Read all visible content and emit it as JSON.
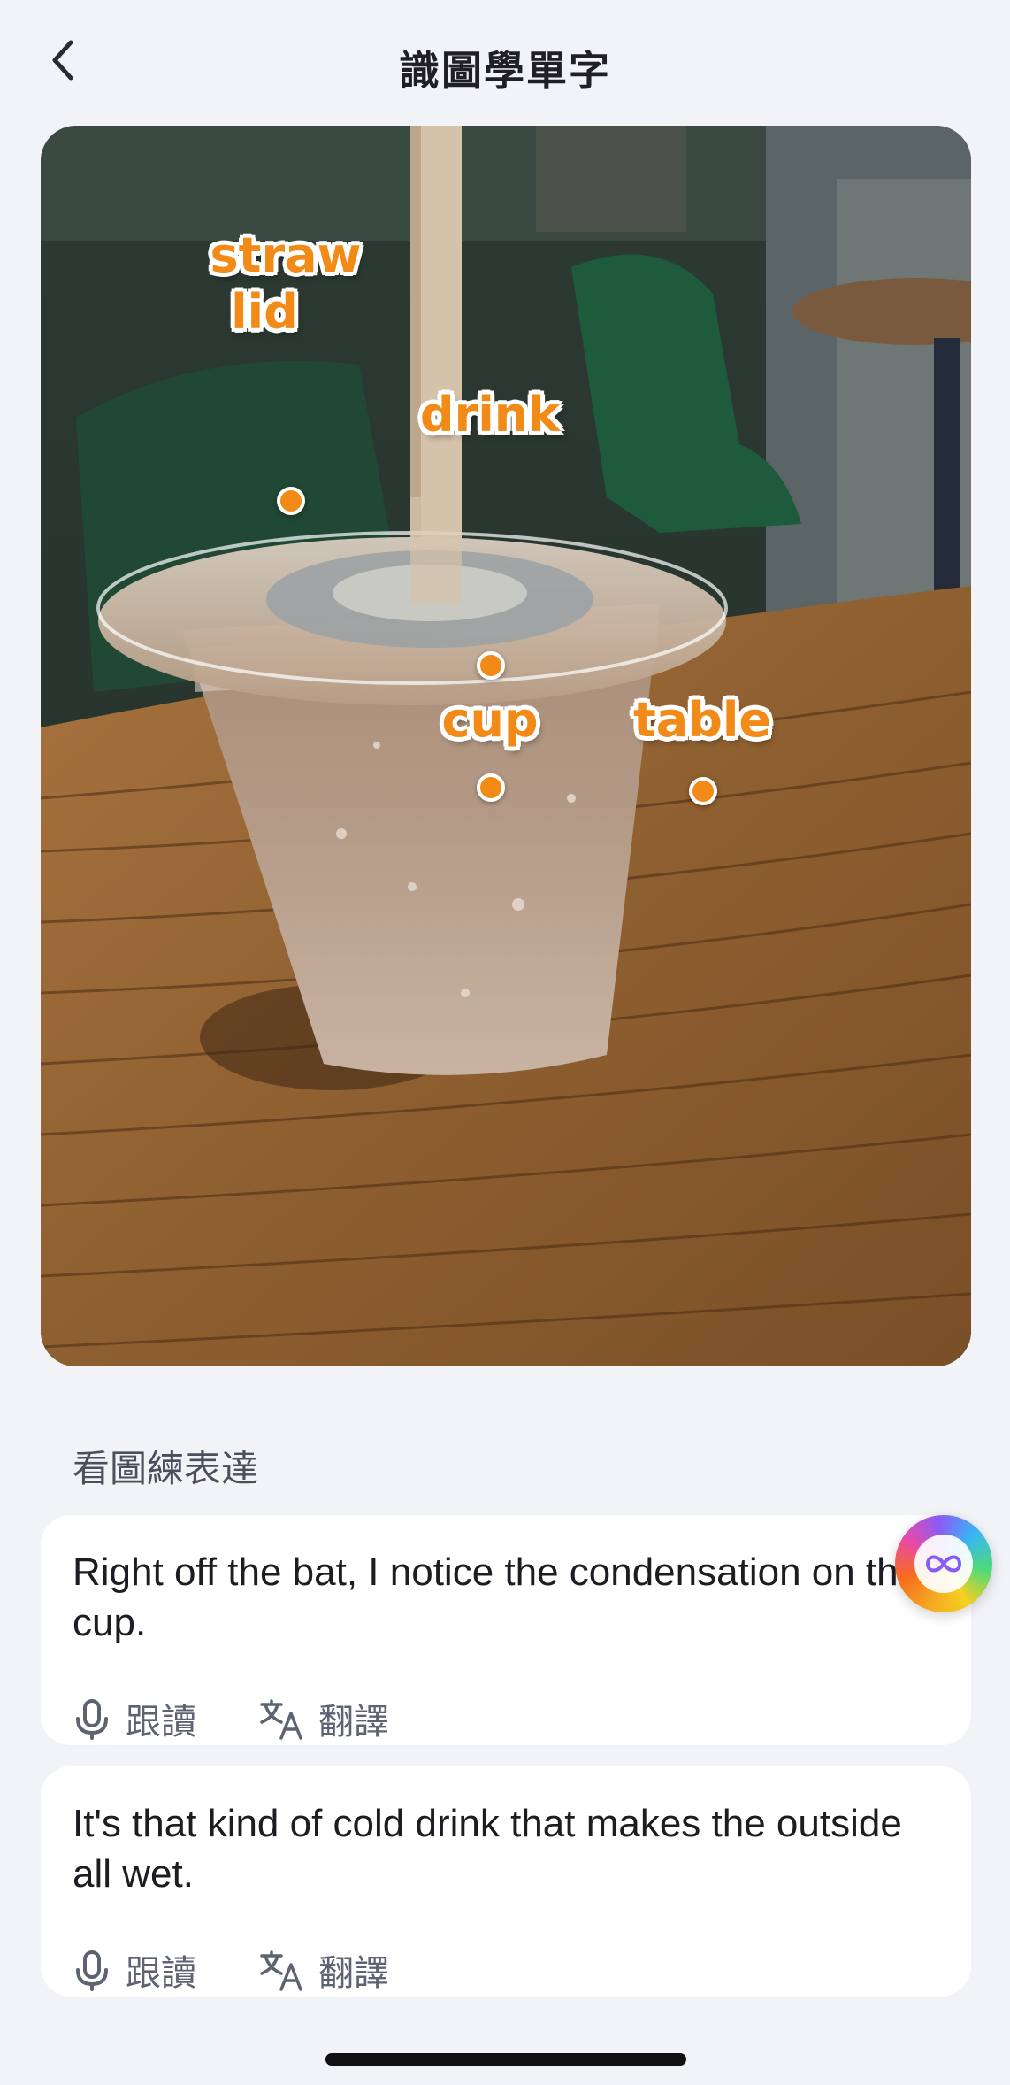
{
  "header": {
    "title": "識圖學單字",
    "back_icon": "chevron-left-icon"
  },
  "photo": {
    "labels": [
      {
        "id": "straw",
        "text": "straw"
      },
      {
        "id": "lid",
        "text": "lid"
      },
      {
        "id": "drink",
        "text": "drink"
      },
      {
        "id": "cup",
        "text": "cup"
      },
      {
        "id": "table",
        "text": "table"
      }
    ],
    "label_color": "#f28a17"
  },
  "section": {
    "title": "看圖練表達"
  },
  "sentences": [
    {
      "text": "Right off the bat, I notice the condensation on the cup.",
      "shadow_label": "跟讀",
      "translate_label": "翻譯"
    },
    {
      "text": "It's that kind of cold drink that makes the outside all wet.",
      "shadow_label": "跟讀",
      "translate_label": "翻譯"
    }
  ],
  "icons": {
    "shadow": "microphone-icon",
    "translate": "translate-icon",
    "assistant": "ai-assistant-icon"
  }
}
